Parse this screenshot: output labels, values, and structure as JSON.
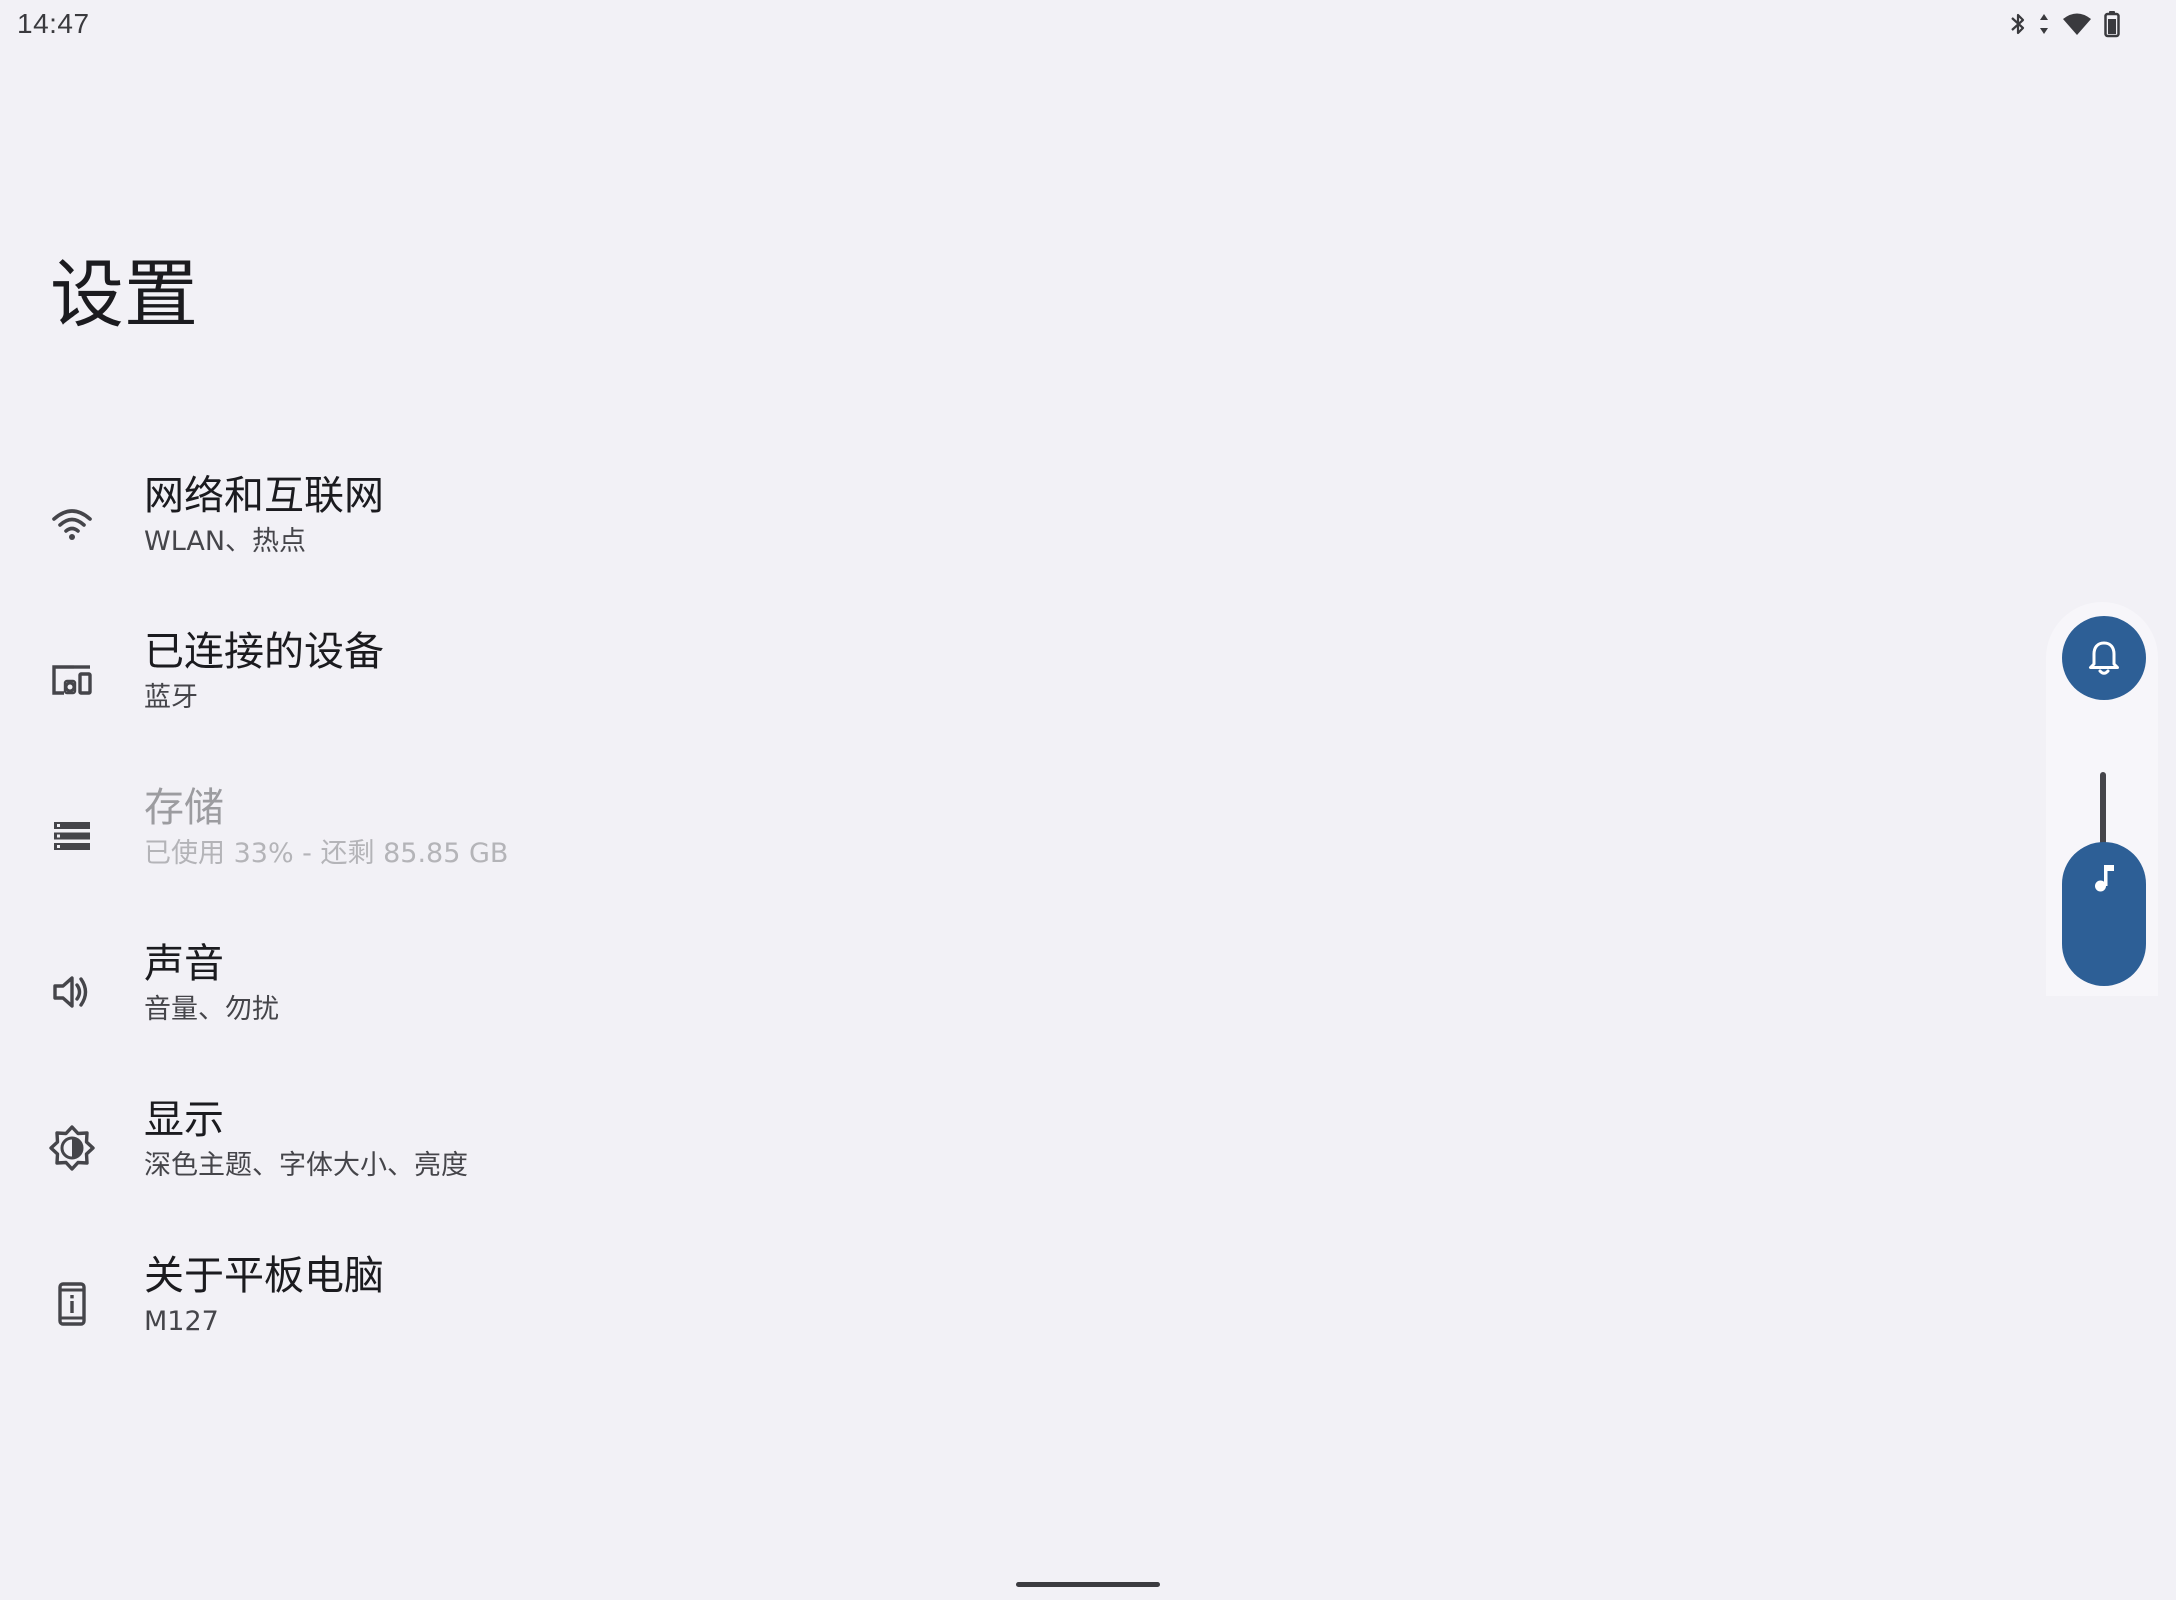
{
  "status_bar": {
    "time": "14:47",
    "icons": [
      "bluetooth-icon",
      "data-arrows-icon",
      "wifi-icon",
      "battery-icon"
    ]
  },
  "page": {
    "title": "设置"
  },
  "settings": {
    "items": [
      {
        "icon": "wifi-icon",
        "title": "网络和互联网",
        "subtitle": "WLAN、热点",
        "enabled": true
      },
      {
        "icon": "devices-icon",
        "title": "已连接的设备",
        "subtitle": "蓝牙",
        "enabled": true
      },
      {
        "icon": "storage-icon",
        "title": "存储",
        "subtitle": "已使用 33% - 还剩 85.85 GB",
        "enabled": false
      },
      {
        "icon": "speaker-icon",
        "title": "声音",
        "subtitle": "音量、勿扰",
        "enabled": true
      },
      {
        "icon": "brightness-icon",
        "title": "显示",
        "subtitle": "深色主题、字体大小、亮度",
        "enabled": true
      },
      {
        "icon": "about-device-icon",
        "title": "关于平板电脑",
        "subtitle": "M127",
        "enabled": true
      }
    ]
  },
  "volume_panel": {
    "accent_color": "#2d5f96",
    "ringer_icon": "bell-icon",
    "stream_icon": "music-note-icon"
  },
  "colors": {
    "background": "#f2f1f6",
    "text_primary": "#1b1b1f",
    "text_secondary": "#45454a",
    "text_disabled": "#9c9ca0"
  }
}
